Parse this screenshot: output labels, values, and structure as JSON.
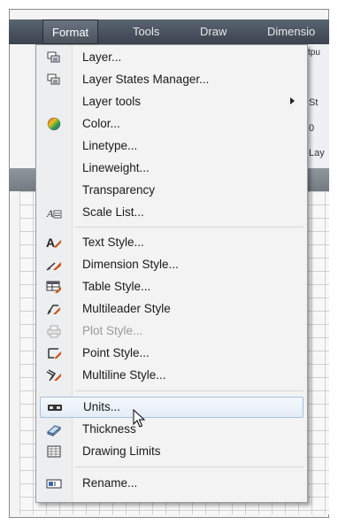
{
  "menubar": {
    "items": [
      {
        "label": "Format"
      },
      {
        "label": "Tools"
      },
      {
        "label": "Draw"
      },
      {
        "label": "Dimensio"
      }
    ],
    "right_fragment": "tpu"
  },
  "background_fragments": [
    "St",
    "0",
    "Lay"
  ],
  "menu": {
    "items": [
      {
        "label": "Layer...",
        "icon": "layer-icon"
      },
      {
        "label": "Layer States Manager...",
        "icon": "layer-states-icon"
      },
      {
        "label": "Layer tools",
        "icon": "",
        "submenu": true
      },
      {
        "label": "Color...",
        "icon": "color-wheel-icon"
      },
      {
        "label": "Linetype...",
        "icon": ""
      },
      {
        "label": "Lineweight...",
        "icon": ""
      },
      {
        "label": "Transparency",
        "icon": ""
      },
      {
        "label": "Scale List...",
        "icon": "scale-list-icon"
      },
      {
        "label": "Text Style...",
        "icon": "text-style-icon"
      },
      {
        "label": "Dimension Style...",
        "icon": "dimension-style-icon"
      },
      {
        "label": "Table Style...",
        "icon": "table-style-icon"
      },
      {
        "label": "Multileader Style",
        "icon": "multileader-style-icon"
      },
      {
        "label": "Plot Style...",
        "icon": "plot-style-icon",
        "disabled": true
      },
      {
        "label": "Point Style...",
        "icon": "point-style-icon"
      },
      {
        "label": "Multiline Style...",
        "icon": "multiline-style-icon"
      },
      {
        "label": "Units...",
        "icon": "units-icon",
        "highlighted": true
      },
      {
        "label": "Thickness",
        "icon": "thickness-icon"
      },
      {
        "label": "Drawing Limits",
        "icon": "drawing-limits-icon"
      },
      {
        "label": "Rename...",
        "icon": "rename-icon"
      }
    ]
  }
}
